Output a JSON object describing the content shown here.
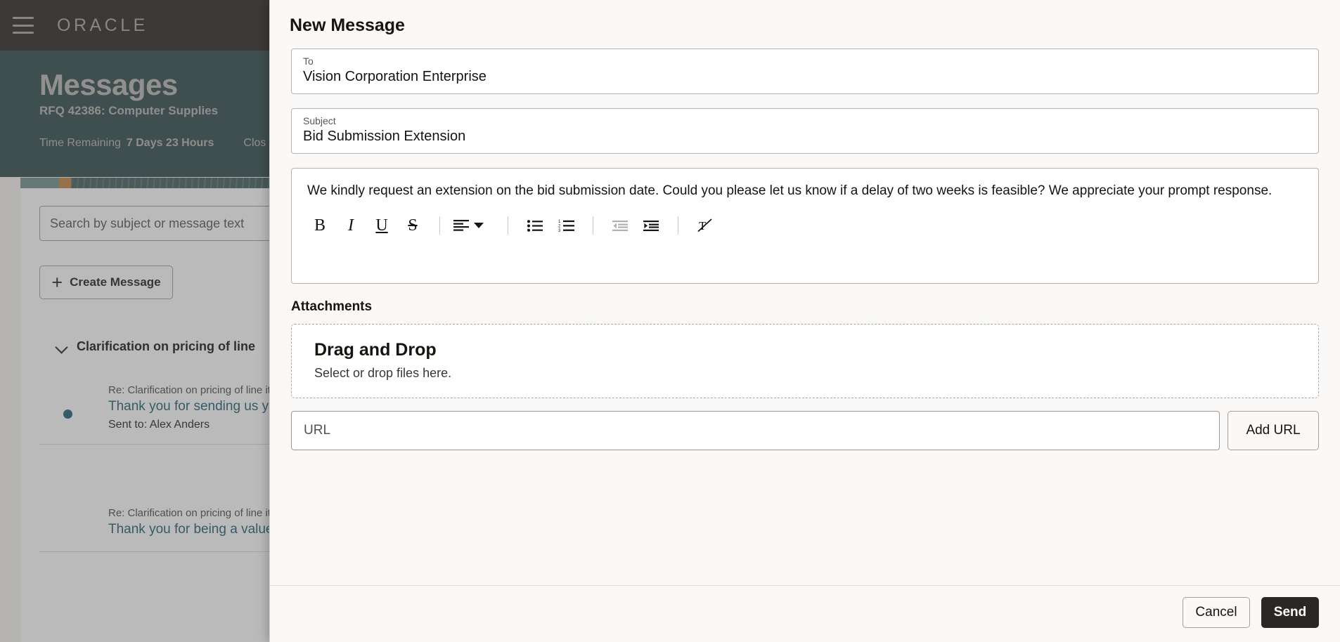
{
  "background": {
    "header": {
      "logo": "ORACLE",
      "menu_icon": "hamburger-icon"
    },
    "hero": {
      "title": "Messages",
      "subtitle": "RFQ 42386: Computer Supplies",
      "time_remaining_label": "Time Remaining",
      "time_remaining_value": "7 Days 23 Hours",
      "close_label": "Clos"
    },
    "panel": {
      "search_placeholder": "Search by subject or message text",
      "create_message_label": "Create Message",
      "thread_title": "Clarification on pricing of line",
      "messages": [
        {
          "re": "Re: Clarification on pricing of line item",
          "preview": "Thank you for sending us yo items. We are looking at mor item: RCV-Laptop What is the",
          "sent_to": "Sent to: Alex Anders"
        },
        {
          "re": "Re: Clarification on pricing of line item",
          "preview": "Thank you for being a valued",
          "sent_to": ""
        }
      ]
    }
  },
  "modal": {
    "title": "New Message",
    "to": {
      "label": "To",
      "value": "Vision Corporation Enterprise"
    },
    "subject": {
      "label": "Subject",
      "value": "Bid Submission Extension"
    },
    "body": {
      "text": "We kindly request an extension on the bid submission date. Could you please let us know if a delay of two weeks is feasible? We appreciate your prompt response."
    },
    "toolbar": [
      {
        "name": "bold-icon",
        "glyph": "B",
        "enabled": true
      },
      {
        "name": "italic-icon",
        "glyph": "I",
        "enabled": true
      },
      {
        "name": "underline-icon",
        "glyph": "U",
        "enabled": true
      },
      {
        "name": "strikethrough-icon",
        "glyph": "S",
        "enabled": true
      },
      {
        "name": "align-icon",
        "glyph": "align",
        "enabled": true
      },
      {
        "name": "bulleted-list-icon",
        "glyph": "ul",
        "enabled": true
      },
      {
        "name": "numbered-list-icon",
        "glyph": "ol",
        "enabled": true
      },
      {
        "name": "outdent-icon",
        "glyph": "outdent",
        "enabled": false
      },
      {
        "name": "indent-icon",
        "glyph": "indent",
        "enabled": true
      },
      {
        "name": "clear-formatting-icon",
        "glyph": "clear",
        "enabled": true
      }
    ],
    "attachments": {
      "label": "Attachments",
      "dropzone_title": "Drag and Drop",
      "dropzone_subtitle": "Select or drop files here.",
      "url_placeholder": "URL",
      "add_url_label": "Add URL"
    },
    "footer": {
      "cancel_label": "Cancel",
      "send_label": "Send"
    }
  },
  "colors": {
    "oracle_header": "#262220",
    "hero_teal": "#2c4646",
    "link_blue": "#1a5a72",
    "send_dark": "#2b2724",
    "modal_bg": "#faf9f7"
  }
}
